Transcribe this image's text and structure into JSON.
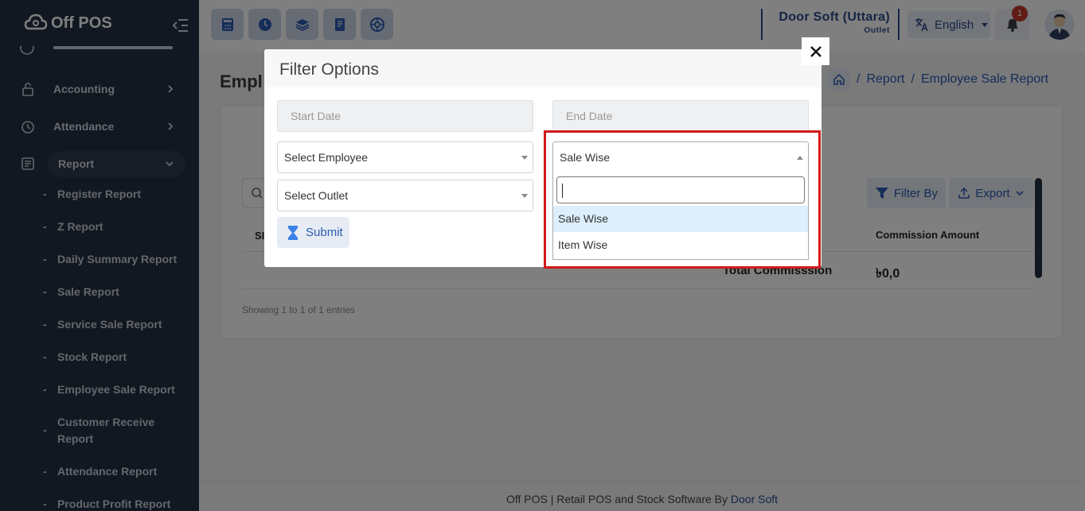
{
  "app": {
    "name": "Off POS"
  },
  "sidebar": {
    "items": [
      {
        "label": "Accounting",
        "icon": "lock-icon"
      },
      {
        "label": "Attendance",
        "icon": "clock-icon"
      },
      {
        "label": "Report",
        "icon": "report-icon"
      }
    ],
    "report_subitems": [
      "Register Report",
      "Z Report",
      "Daily Summary Report",
      "Sale Report",
      "Service Sale Report",
      "Stock Report",
      "Employee Sale Report",
      "Customer Receive Report",
      "Attendance Report",
      "Product Profit Report"
    ],
    "dash": "-"
  },
  "topbar": {
    "outlet_name": "Door Soft (Uttara)",
    "outlet_sub": "Outlet",
    "language": "English",
    "notification_count": "1",
    "quick_icons": [
      "calculator-icon",
      "clock-icon",
      "layers-icon",
      "document-icon",
      "settings-circle-icon"
    ]
  },
  "page": {
    "title": "Employee Sale Report",
    "title_visible": "Empl",
    "breadcrumb": [
      "Report",
      "Employee Sale Report"
    ],
    "filter_label": "Filter By",
    "export_label": "Export",
    "table_header_sn": "SI",
    "table_header_commission": "Commission Amount",
    "total_label": "Total Commisssion",
    "total_value": "৳0,0",
    "showing": "Showing 1 to 1 of 1 entries"
  },
  "footer": {
    "text": "Off POS | Retail POS and Stock Software By ",
    "link": "Door Soft"
  },
  "modal": {
    "title": "Filter Options",
    "start_date_placeholder": "Start Date",
    "end_date_placeholder": "End Date",
    "employee_select": "Select Employee",
    "outlet_select": "Select Outlet",
    "type_select": "Sale Wise",
    "submit_label": "Submit",
    "dropdown": {
      "search_value": "",
      "options": [
        "Sale Wise",
        "Item Wise"
      ],
      "highlighted": "Sale Wise"
    }
  },
  "colors": {
    "sidebar": "#243043",
    "accent": "#2a5bb0",
    "highlight_border": "#d01a1a"
  }
}
